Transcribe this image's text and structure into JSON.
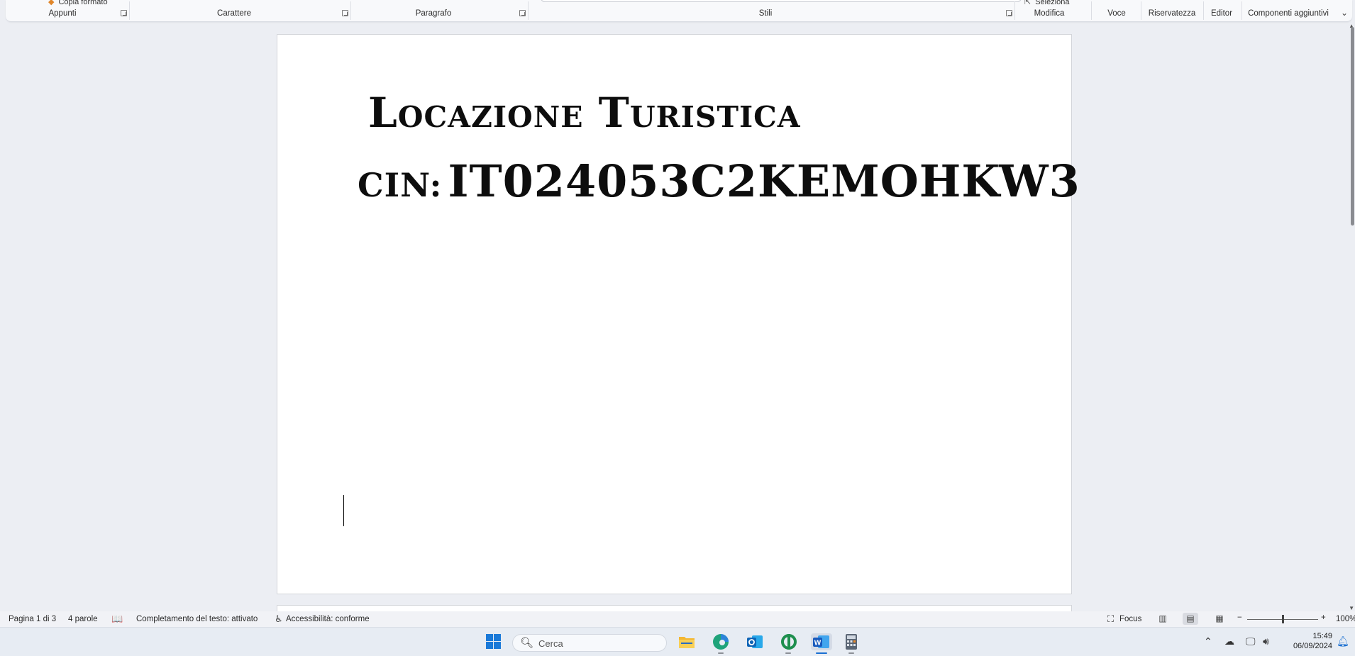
{
  "ribbon": {
    "clipboard_top": "Copia formato",
    "select_top": "Seleziona",
    "groups": {
      "appunti": "Appunti",
      "carattere": "Carattere",
      "paragrafo": "Paragrafo",
      "stili": "Stili",
      "modifica": "Modifica",
      "voce": "Voce",
      "riservatezza": "Riservatezza",
      "editor": "Editor",
      "componenti": "Componenti aggiuntivi"
    }
  },
  "document": {
    "line1": "Locazione Turistica",
    "line2_label": "CIN:",
    "line2_code": "IT024053C2KEMOHKW3"
  },
  "statusbar": {
    "page": "Pagina 1 di 3",
    "words": "4 parole",
    "text_prediction": "Completamento del testo: attivato",
    "accessibility": "Accessibilità: conforme",
    "focus": "Focus",
    "zoom_minus": "−",
    "zoom_plus": "+",
    "zoom": "100%"
  },
  "taskbar": {
    "search_placeholder": "Cerca",
    "time": "15:49",
    "date": "06/09/2024"
  },
  "icons": {
    "word": "word-icon",
    "start": "windows-start-icon",
    "explorer": "file-explorer-icon",
    "edge": "edge-icon",
    "outlook": "outlook-icon",
    "calculator": "calculator-icon"
  },
  "colors": {
    "accent": "#1a6fd1",
    "word_blue": "#185abd",
    "page_bg": "#ffffff",
    "canvas_bg": "#eceef3"
  }
}
